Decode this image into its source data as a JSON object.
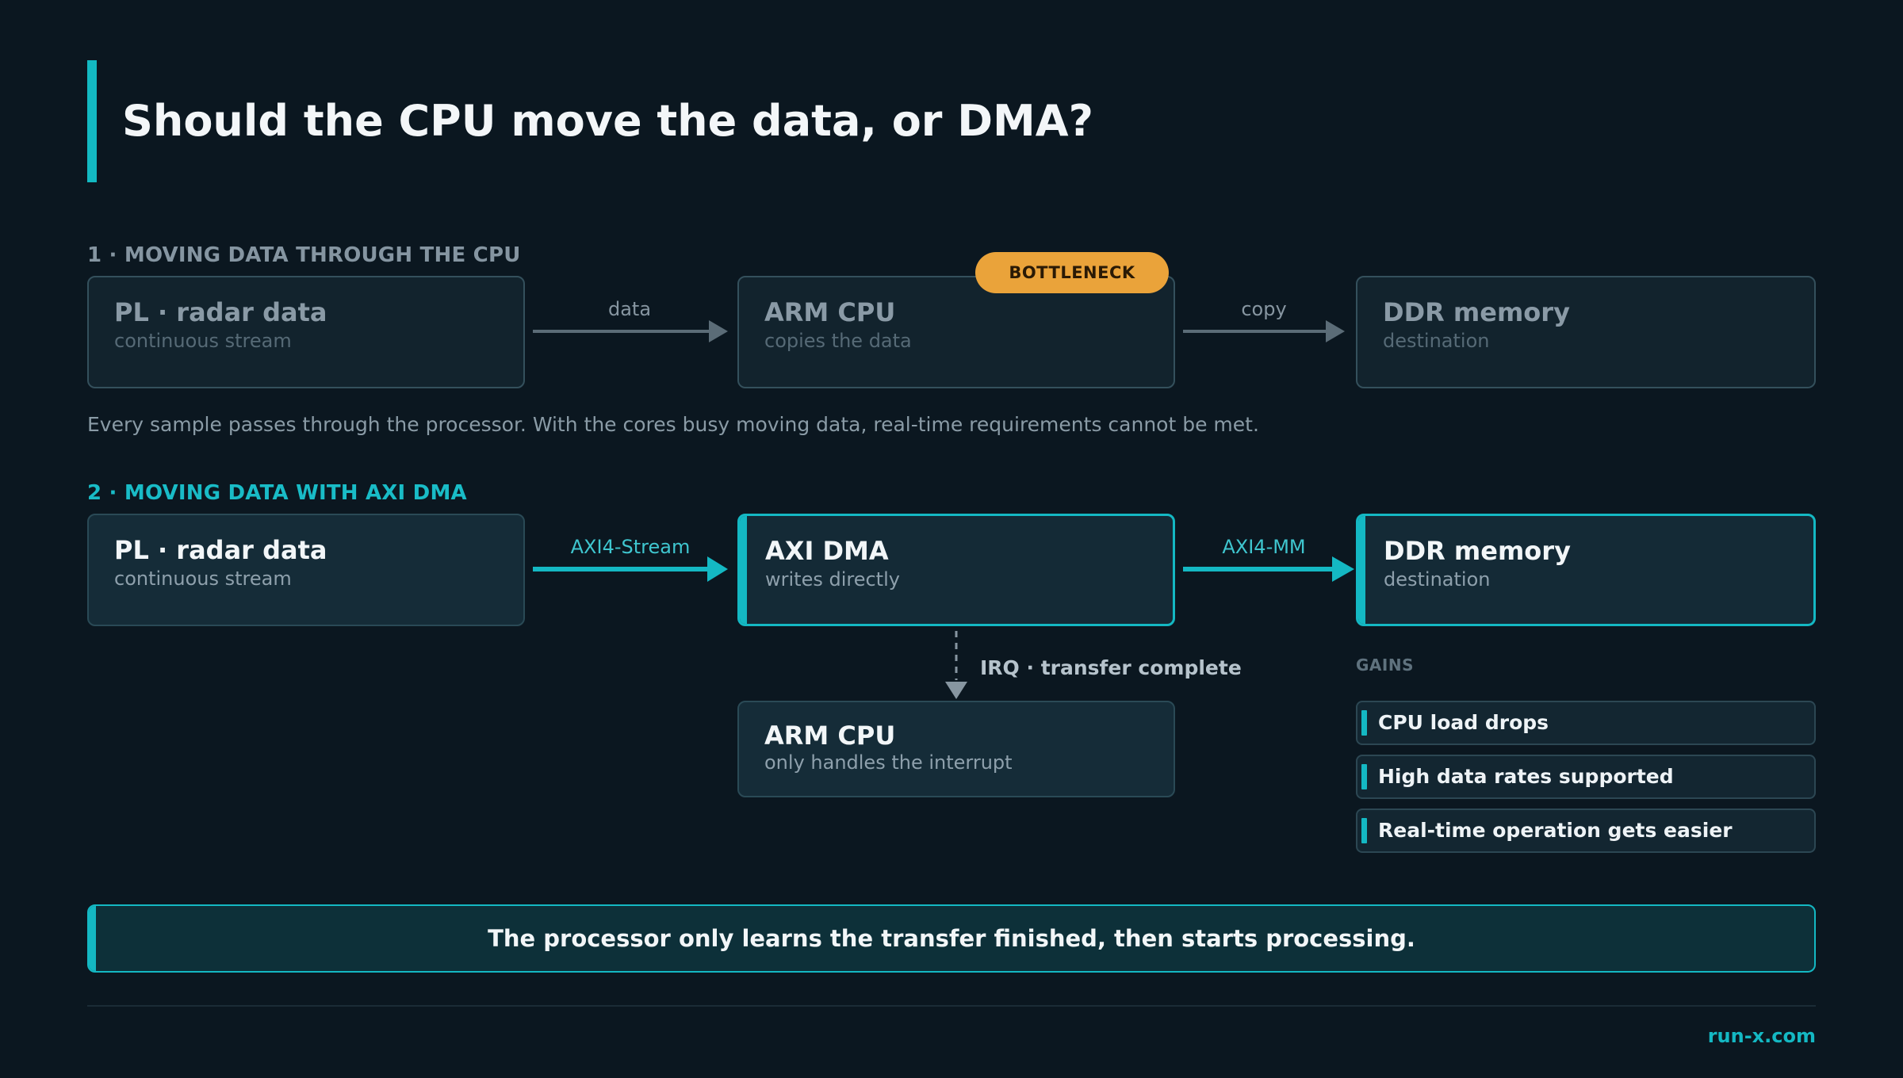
{
  "title": "Should the CPU move the data, or DMA?",
  "section1": {
    "label": "1  ·  MOVING DATA THROUGH THE CPU",
    "source": {
      "title": "PL  ·  radar data",
      "subtitle": "continuous stream"
    },
    "arrow1_label": "data",
    "cpu": {
      "title": "ARM CPU",
      "subtitle": "copies the data",
      "badge": "BOTTLENECK"
    },
    "arrow2_label": "copy",
    "dest": {
      "title": "DDR memory",
      "subtitle": "destination"
    },
    "description": "Every sample passes through the processor. With the cores busy moving data, real-time requirements cannot be met."
  },
  "section2": {
    "label": "2  ·  MOVING DATA WITH AXI DMA",
    "source": {
      "title": "PL  ·  radar data",
      "subtitle": "continuous stream"
    },
    "arrow1_label": "AXI4-Stream",
    "dma": {
      "title": "AXI DMA",
      "subtitle": "writes directly"
    },
    "arrow2_label": "AXI4-MM",
    "dest": {
      "title": "DDR memory",
      "subtitle": "destination"
    },
    "irq_label": "IRQ  ·  transfer complete",
    "cpu": {
      "title": "ARM CPU",
      "subtitle": "only handles the interrupt"
    },
    "gains_label": "GAINS",
    "gains": [
      "CPU load drops",
      "High data rates supported",
      "Real-time operation gets easier"
    ]
  },
  "callout": "The processor only learns the transfer finished, then starts processing.",
  "footer": "run-x.com",
  "colors": {
    "background": "#0b1720",
    "accent": "#14b8c3",
    "badge": "#eaa33a",
    "dim_arrow": "#5b6c77"
  }
}
